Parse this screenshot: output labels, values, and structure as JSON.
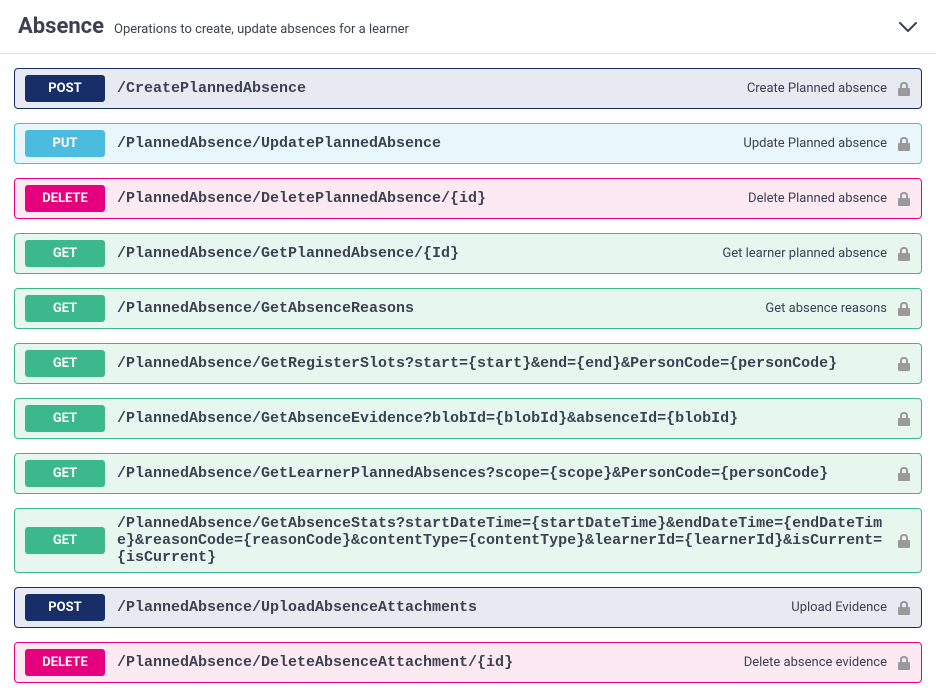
{
  "section": {
    "title": "Absence",
    "description": "Operations to create, update absences for a learner"
  },
  "operations": [
    {
      "method": "POST",
      "path": "/CreatePlannedAbsence",
      "summary": "Create Planned absence"
    },
    {
      "method": "PUT",
      "path": "/PlannedAbsence/UpdatePlannedAbsence",
      "summary": "Update Planned absence"
    },
    {
      "method": "DELETE",
      "path": "/PlannedAbsence/DeletePlannedAbsence/{id}",
      "summary": "Delete Planned absence"
    },
    {
      "method": "GET",
      "path": "/PlannedAbsence/GetPlannedAbsence/{Id}",
      "summary": "Get learner planned absence"
    },
    {
      "method": "GET",
      "path": "/PlannedAbsence/GetAbsenceReasons",
      "summary": "Get absence reasons"
    },
    {
      "method": "GET",
      "path": "/PlannedAbsence/GetRegisterSlots?start={start}&end={end}&PersonCode={personCode}",
      "summary": ""
    },
    {
      "method": "GET",
      "path": "/PlannedAbsence/GetAbsenceEvidence?blobId={blobId}&absenceId={blobId}",
      "summary": ""
    },
    {
      "method": "GET",
      "path": "/PlannedAbsence/GetLearnerPlannedAbsences?scope={scope}&PersonCode={personCode}",
      "summary": ""
    },
    {
      "method": "GET",
      "path": "/PlannedAbsence/GetAbsenceStats?startDateTime={startDateTime}&endDateTime={endDateTime}&reasonCode={reasonCode}&contentType={contentType}&learnerId={learnerId}&isCurrent={isCurrent}",
      "summary": ""
    },
    {
      "method": "POST",
      "path": "/PlannedAbsence/UploadAbsenceAttachments",
      "summary": "Upload Evidence"
    },
    {
      "method": "DELETE",
      "path": "/PlannedAbsence/DeleteAbsenceAttachment/{id}",
      "summary": "Delete absence evidence"
    }
  ]
}
